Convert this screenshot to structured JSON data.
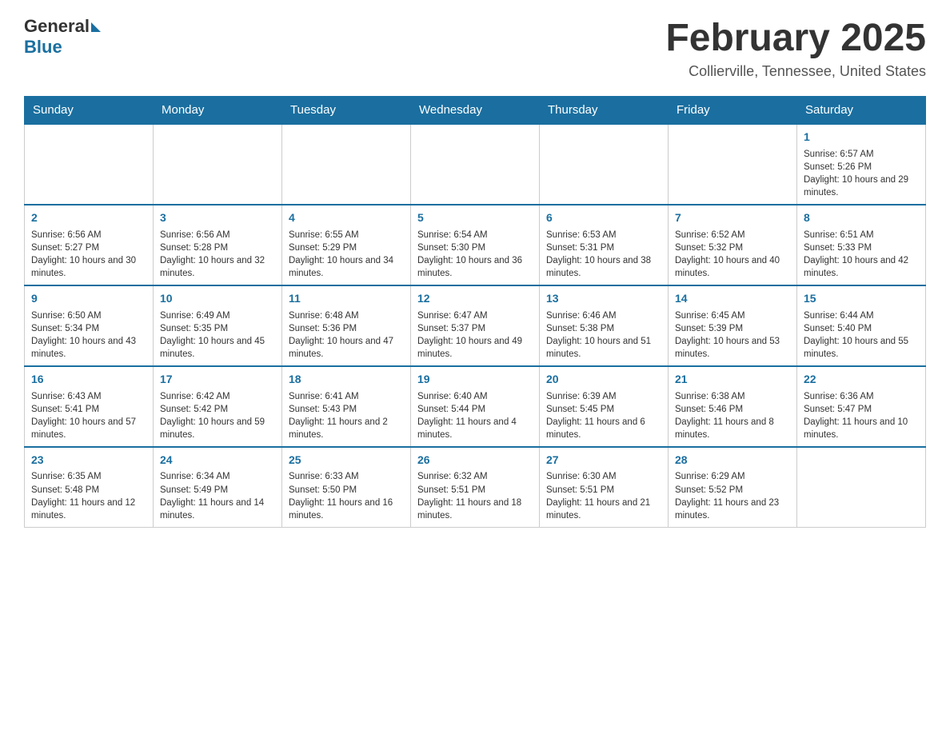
{
  "header": {
    "logo": {
      "general": "General",
      "blue": "Blue"
    },
    "title": "February 2025",
    "subtitle": "Collierville, Tennessee, United States"
  },
  "days_of_week": [
    "Sunday",
    "Monday",
    "Tuesday",
    "Wednesday",
    "Thursday",
    "Friday",
    "Saturday"
  ],
  "weeks": [
    [
      {
        "day": "",
        "info": ""
      },
      {
        "day": "",
        "info": ""
      },
      {
        "day": "",
        "info": ""
      },
      {
        "day": "",
        "info": ""
      },
      {
        "day": "",
        "info": ""
      },
      {
        "day": "",
        "info": ""
      },
      {
        "day": "1",
        "info": "Sunrise: 6:57 AM\nSunset: 5:26 PM\nDaylight: 10 hours and 29 minutes."
      }
    ],
    [
      {
        "day": "2",
        "info": "Sunrise: 6:56 AM\nSunset: 5:27 PM\nDaylight: 10 hours and 30 minutes."
      },
      {
        "day": "3",
        "info": "Sunrise: 6:56 AM\nSunset: 5:28 PM\nDaylight: 10 hours and 32 minutes."
      },
      {
        "day": "4",
        "info": "Sunrise: 6:55 AM\nSunset: 5:29 PM\nDaylight: 10 hours and 34 minutes."
      },
      {
        "day": "5",
        "info": "Sunrise: 6:54 AM\nSunset: 5:30 PM\nDaylight: 10 hours and 36 minutes."
      },
      {
        "day": "6",
        "info": "Sunrise: 6:53 AM\nSunset: 5:31 PM\nDaylight: 10 hours and 38 minutes."
      },
      {
        "day": "7",
        "info": "Sunrise: 6:52 AM\nSunset: 5:32 PM\nDaylight: 10 hours and 40 minutes."
      },
      {
        "day": "8",
        "info": "Sunrise: 6:51 AM\nSunset: 5:33 PM\nDaylight: 10 hours and 42 minutes."
      }
    ],
    [
      {
        "day": "9",
        "info": "Sunrise: 6:50 AM\nSunset: 5:34 PM\nDaylight: 10 hours and 43 minutes."
      },
      {
        "day": "10",
        "info": "Sunrise: 6:49 AM\nSunset: 5:35 PM\nDaylight: 10 hours and 45 minutes."
      },
      {
        "day": "11",
        "info": "Sunrise: 6:48 AM\nSunset: 5:36 PM\nDaylight: 10 hours and 47 minutes."
      },
      {
        "day": "12",
        "info": "Sunrise: 6:47 AM\nSunset: 5:37 PM\nDaylight: 10 hours and 49 minutes."
      },
      {
        "day": "13",
        "info": "Sunrise: 6:46 AM\nSunset: 5:38 PM\nDaylight: 10 hours and 51 minutes."
      },
      {
        "day": "14",
        "info": "Sunrise: 6:45 AM\nSunset: 5:39 PM\nDaylight: 10 hours and 53 minutes."
      },
      {
        "day": "15",
        "info": "Sunrise: 6:44 AM\nSunset: 5:40 PM\nDaylight: 10 hours and 55 minutes."
      }
    ],
    [
      {
        "day": "16",
        "info": "Sunrise: 6:43 AM\nSunset: 5:41 PM\nDaylight: 10 hours and 57 minutes."
      },
      {
        "day": "17",
        "info": "Sunrise: 6:42 AM\nSunset: 5:42 PM\nDaylight: 10 hours and 59 minutes."
      },
      {
        "day": "18",
        "info": "Sunrise: 6:41 AM\nSunset: 5:43 PM\nDaylight: 11 hours and 2 minutes."
      },
      {
        "day": "19",
        "info": "Sunrise: 6:40 AM\nSunset: 5:44 PM\nDaylight: 11 hours and 4 minutes."
      },
      {
        "day": "20",
        "info": "Sunrise: 6:39 AM\nSunset: 5:45 PM\nDaylight: 11 hours and 6 minutes."
      },
      {
        "day": "21",
        "info": "Sunrise: 6:38 AM\nSunset: 5:46 PM\nDaylight: 11 hours and 8 minutes."
      },
      {
        "day": "22",
        "info": "Sunrise: 6:36 AM\nSunset: 5:47 PM\nDaylight: 11 hours and 10 minutes."
      }
    ],
    [
      {
        "day": "23",
        "info": "Sunrise: 6:35 AM\nSunset: 5:48 PM\nDaylight: 11 hours and 12 minutes."
      },
      {
        "day": "24",
        "info": "Sunrise: 6:34 AM\nSunset: 5:49 PM\nDaylight: 11 hours and 14 minutes."
      },
      {
        "day": "25",
        "info": "Sunrise: 6:33 AM\nSunset: 5:50 PM\nDaylight: 11 hours and 16 minutes."
      },
      {
        "day": "26",
        "info": "Sunrise: 6:32 AM\nSunset: 5:51 PM\nDaylight: 11 hours and 18 minutes."
      },
      {
        "day": "27",
        "info": "Sunrise: 6:30 AM\nSunset: 5:51 PM\nDaylight: 11 hours and 21 minutes."
      },
      {
        "day": "28",
        "info": "Sunrise: 6:29 AM\nSunset: 5:52 PM\nDaylight: 11 hours and 23 minutes."
      },
      {
        "day": "",
        "info": ""
      }
    ]
  ]
}
